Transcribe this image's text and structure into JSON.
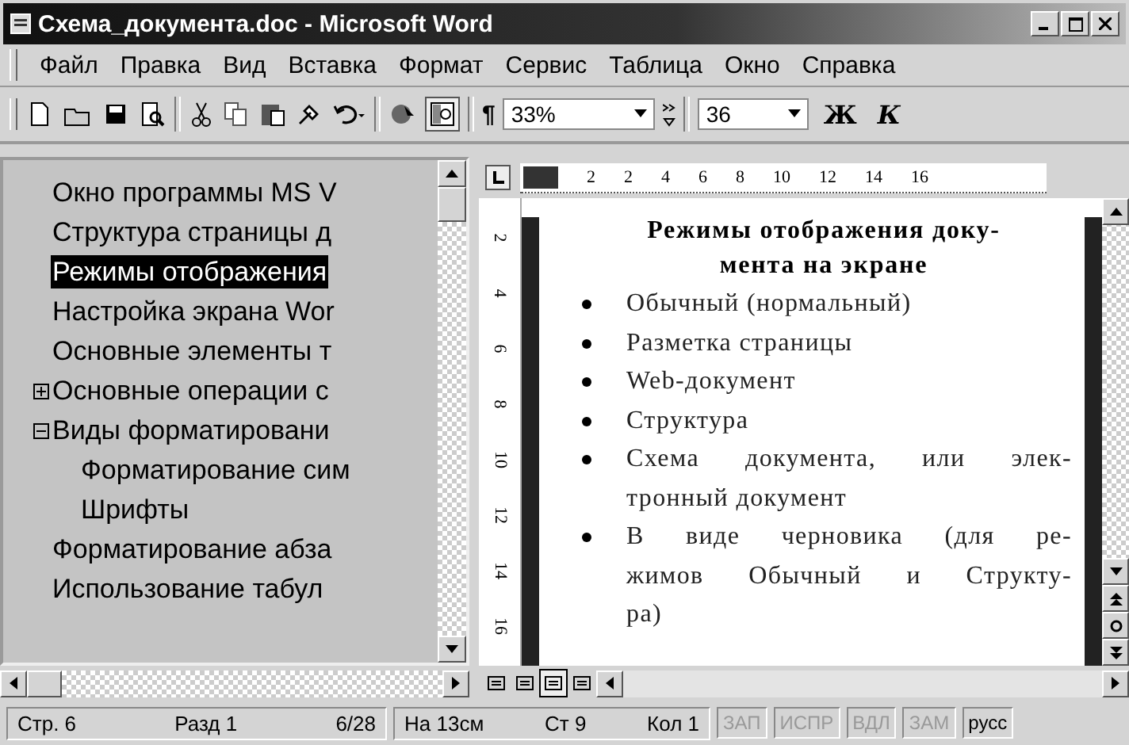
{
  "window": {
    "title": "Схема_документа.doc - Microsoft Word"
  },
  "menu": [
    "Файл",
    "Правка",
    "Вид",
    "Вставка",
    "Формат",
    "Сервис",
    "Таблица",
    "Окно",
    "Справка"
  ],
  "toolbar": {
    "paragraph_mark": "¶",
    "zoom": "33%",
    "font_size": "36",
    "bold": "Ж",
    "italic": "К"
  },
  "document_map": [
    {
      "text": "Окно программы MS V",
      "selected": false
    },
    {
      "text": "Структура страницы д",
      "selected": false
    },
    {
      "text": "Режимы отображения",
      "selected": true
    },
    {
      "text": "Настройка экрана Wor",
      "selected": false
    },
    {
      "text": "Основные элементы т",
      "selected": false
    },
    {
      "text": "Основные операции с",
      "selected": false,
      "expanded": false
    },
    {
      "text": "Виды форматировани",
      "selected": false,
      "expanded": true,
      "children": [
        {
          "text": "Форматирование сим",
          "selected": false
        },
        {
          "text": "Шрифты",
          "selected": false
        }
      ]
    },
    {
      "text": "Форматирование абза",
      "selected": false
    },
    {
      "text": "Использование табул",
      "selected": false
    }
  ],
  "ruler": {
    "horizontal": [
      "2",
      "2",
      "4",
      "6",
      "8",
      "10",
      "12",
      "14",
      "16"
    ],
    "vertical": [
      "2",
      "4",
      "6",
      "8",
      "10",
      "12",
      "14",
      "16"
    ]
  },
  "page": {
    "heading": [
      "Режимы отображения доку-",
      "мента на экране"
    ],
    "bullets": [
      [
        "Обычный (нормальный)"
      ],
      [
        "Разметка страницы"
      ],
      [
        "Web-документ"
      ],
      [
        "Структура"
      ],
      [
        "Схема документа, или элек-",
        "тронный документ"
      ],
      [
        "В виде черновика (для ре-",
        "жимов Обычный и Структу-",
        "ра)"
      ]
    ]
  },
  "view_buttons": [
    {
      "selected": false
    },
    {
      "selected": false
    },
    {
      "selected": true
    },
    {
      "selected": false
    }
  ],
  "status_bar": {
    "page": "Стр. 6",
    "section": "Разд 1",
    "pages": "6/28",
    "at": "На 13см",
    "line": "Ст 9",
    "column": "Кол 1",
    "indicators": [
      {
        "text": "ЗАП",
        "disabled": true
      },
      {
        "text": "ИСПР",
        "disabled": true
      },
      {
        "text": "ВДЛ",
        "disabled": true
      },
      {
        "text": "ЗАМ",
        "disabled": true
      },
      {
        "text": "русс",
        "disabled": false
      }
    ]
  }
}
